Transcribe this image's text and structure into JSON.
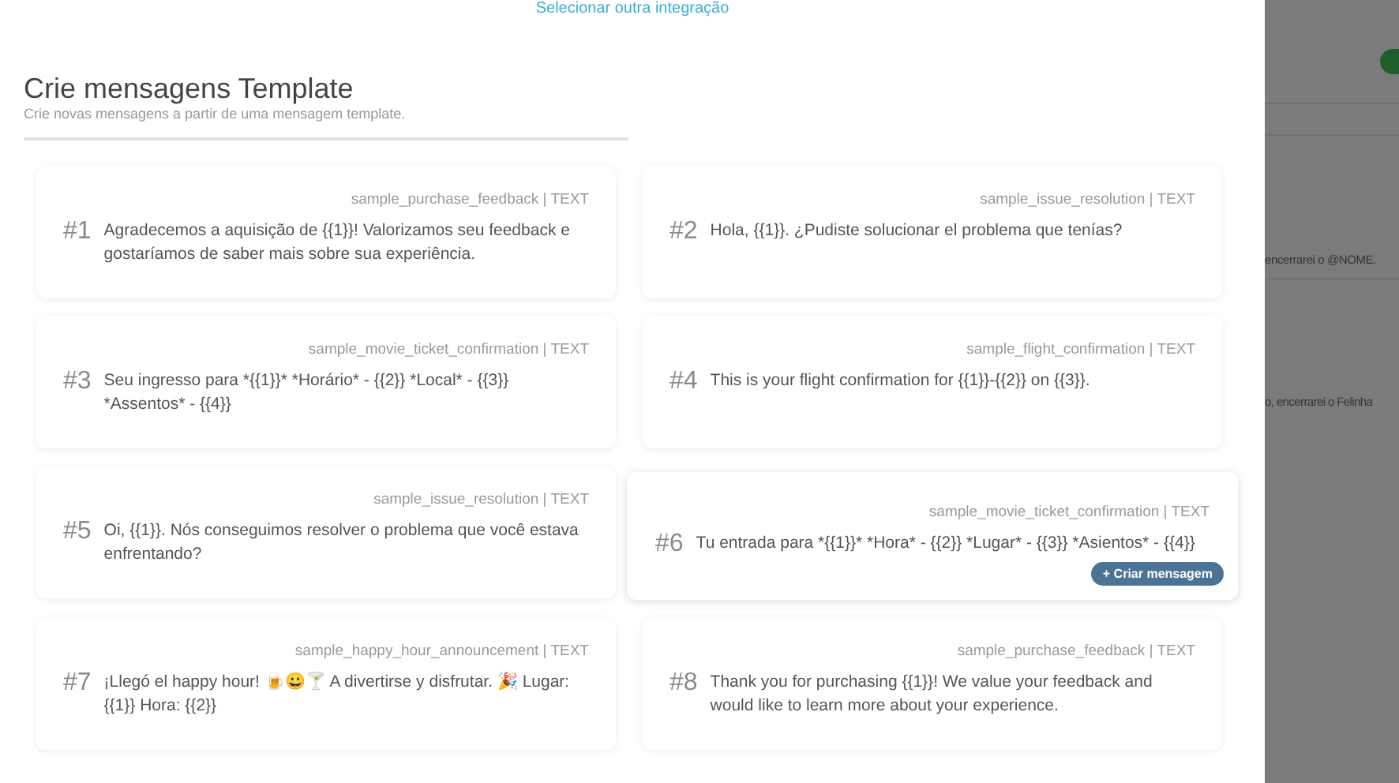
{
  "top_link": "Selecionar outra integração",
  "header": {
    "title": "Crie mensagens Template",
    "subtitle": "Crie novas mensagens a partir de uma mensagem template."
  },
  "templates": [
    {
      "number": "#1",
      "name": "sample_purchase_feedback | TEXT",
      "body": "Agradecemos a aquisição de {{1}}! Valorizamos seu feedback e gostaríamos de saber mais sobre sua experiência.",
      "hovered": false
    },
    {
      "number": "#2",
      "name": "sample_issue_resolution | TEXT",
      "body": "Hola, {{1}}. ¿Pudiste solucionar el problema que tenías?",
      "hovered": false
    },
    {
      "number": "#3",
      "name": "sample_movie_ticket_confirmation | TEXT",
      "body": "Seu ingresso para *{{1}}* *Horário* - {{2}} *Local* - {{3}} *Assentos* - {{4}}",
      "hovered": false
    },
    {
      "number": "#4",
      "name": "sample_flight_confirmation | TEXT",
      "body": "This is your flight confirmation for {{1}}-{{2}} on {{3}}.",
      "hovered": false
    },
    {
      "number": "#5",
      "name": "sample_issue_resolution | TEXT",
      "body": "Oi, {{1}}. Nós conseguimos resolver o problema que você estava enfrentando?",
      "hovered": false
    },
    {
      "number": "#6",
      "name": "sample_movie_ticket_confirmation | TEXT",
      "body": "Tu entrada para *{{1}}* *Hora* - {{2}} *Lugar* - {{3}} *Asientos* - {{4}}",
      "hovered": true,
      "button": "+ Criar mensagem"
    },
    {
      "number": "#7",
      "name": "sample_happy_hour_announcement | TEXT",
      "body": "¡Llegó el happy hour! 🍺😀🍸 A divertirse y disfrutar. 🎉 Lugar: {{1}} Hora: {{2}}",
      "hovered": false
    },
    {
      "number": "#8",
      "name": "sample_purchase_feedback | TEXT",
      "body": "Thank you for purchasing {{1}}! We value your feedback and would like to learn more about your experience.",
      "hovered": false
    }
  ],
  "background_messages": [
    "encerrarei o @NOME.",
    "o, encerrarei o Felinha"
  ]
}
